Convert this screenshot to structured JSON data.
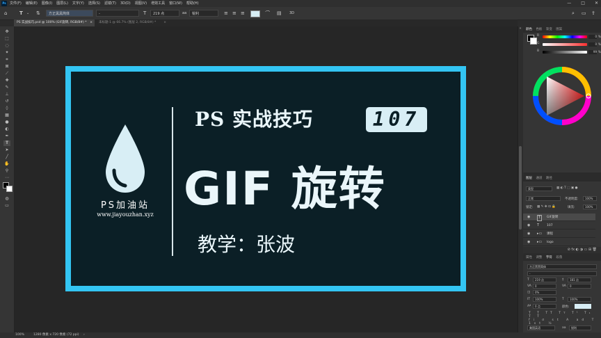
{
  "menubar": {
    "items": [
      "文件(F)",
      "编辑(E)",
      "图像(I)",
      "图层(L)",
      "文字(Y)",
      "选择(S)",
      "滤镜(T)",
      "3D(D)",
      "视图(V)",
      "增效工具",
      "窗口(W)",
      "帮助(H)"
    ],
    "window_min": "—",
    "window_max": "□",
    "window_close": "✕"
  },
  "options": {
    "font_family": "方正黑黑简体",
    "font_style": "-",
    "font_size": "219 点",
    "antialias": "锐利"
  },
  "tabs": [
    {
      "label": "PS 实战技巧.psd @ 100% (GIF旋转, RGB/8#) *",
      "close": "×"
    },
    {
      "label": "未标题-1 @ 66.7% (图层 2, RGB/8#) *",
      "close": "×"
    }
  ],
  "canvas": {
    "logo_text": "PS加油站",
    "logo_url": "www.jiayouzhan.xyz",
    "title": "PS 实战技巧",
    "badge": "107",
    "headline": "GIF 旋转",
    "teacher": "教学：张波",
    "frame_color": "#33c5f3",
    "bg_color": "#0b1f26"
  },
  "statusbar": {
    "zoom": "100%",
    "doc_info": "1280 像素 x 720 像素 (72 ppi)"
  },
  "color_panel": {
    "tabs": [
      "颜色",
      "色板",
      "渐变",
      "图案"
    ],
    "rows": [
      {
        "label": "R",
        "value": "0"
      },
      {
        "label": "G",
        "value": "0"
      },
      {
        "label": "B",
        "value": "99"
      }
    ],
    "units": [
      "%",
      "%",
      "%"
    ]
  },
  "layers_panel": {
    "tabs": [
      "图层",
      "通道",
      "路径"
    ],
    "filter": "类型",
    "blend_mode": "正常",
    "opacity_label": "不透明度:",
    "opacity": "100%",
    "lock_label": "锁定:",
    "fill_label": "填充:",
    "fill": "100%",
    "layers": [
      {
        "icon": "T",
        "name": "GIF旋转"
      },
      {
        "icon": "T",
        "name": "107"
      },
      {
        "icon": "▸▭",
        "name": "课程"
      },
      {
        "icon": "▸▭",
        "name": "logo"
      }
    ]
  },
  "char_panel": {
    "tabs": [
      "属性",
      "调整",
      "字符",
      "段落"
    ],
    "font_family": "方正黑黑简体",
    "font_style": "-",
    "size": "219 点",
    "leading": "181 点",
    "kerning": "0",
    "tracking": "0",
    "scale_v": "100%",
    "scale_h": "100%",
    "baseline": "0 点",
    "color_label": "颜色:",
    "percent": "0%",
    "language": "美国英语",
    "antialias": "锐利"
  }
}
